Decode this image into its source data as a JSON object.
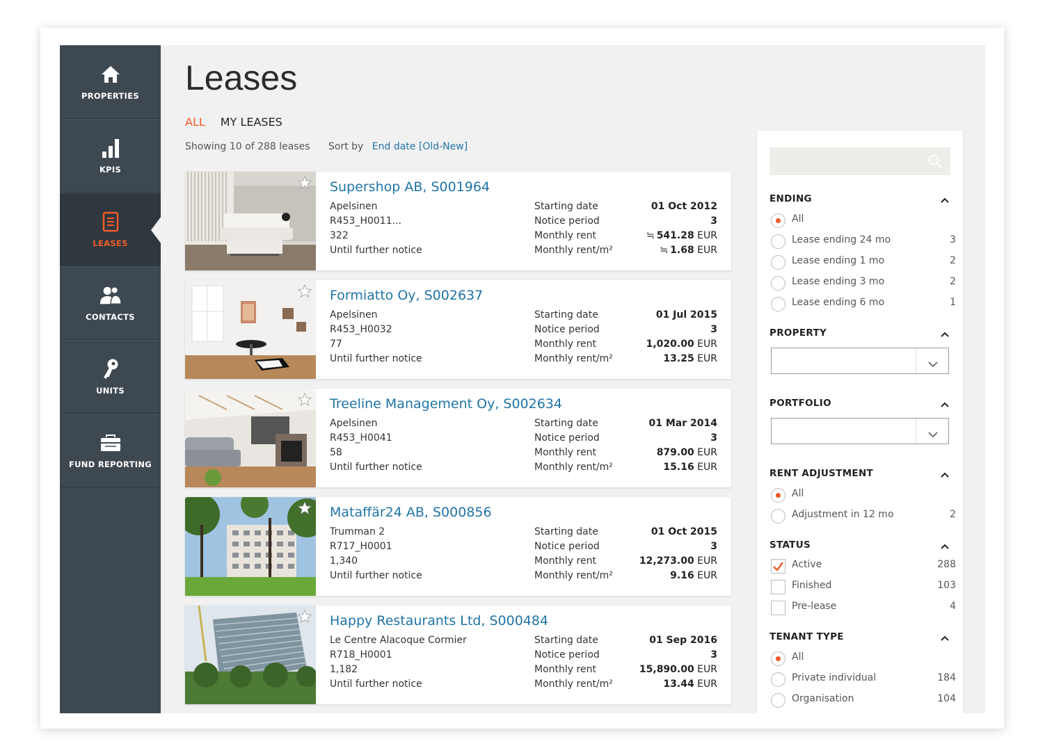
{
  "sidebar": {
    "items": [
      {
        "label": "PROPERTIES",
        "icon": "home-icon",
        "active": false
      },
      {
        "label": "KPIS",
        "icon": "bar-chart-icon",
        "active": false
      },
      {
        "label": "LEASES",
        "icon": "document-icon",
        "active": true
      },
      {
        "label": "CONTACTS",
        "icon": "people-icon",
        "active": false
      },
      {
        "label": "UNITS",
        "icon": "key-icon",
        "active": false
      },
      {
        "label": "FUND REPORTING",
        "icon": "briefcase-icon",
        "active": false
      }
    ]
  },
  "page": {
    "title": "Leases",
    "tabs": [
      "ALL",
      "MY LEASES"
    ],
    "showing": "Showing 10 of 288 leases",
    "sort_label": "Sort by",
    "sort_value": "End date [Old-New]"
  },
  "labels": {
    "starting_date": "Starting date",
    "notice_period": "Notice period",
    "monthly_rent": "Monthly rent",
    "monthly_rent_m2": "Monthly rent/m²",
    "currency": "EUR",
    "approx": "≒"
  },
  "leases": [
    {
      "title": "Supershop AB, S001964",
      "property": "Apelsinen",
      "unit": "R453_H0011...",
      "area": "322",
      "term": "Until further notice",
      "start": "01 Oct 2012",
      "notice": "3",
      "rent": "541.28",
      "rent_m2": "1.68",
      "approx": true
    },
    {
      "title": "Formiatto Oy, S002637",
      "property": "Apelsinen",
      "unit": "R453_H0032",
      "area": "77",
      "term": "Until further notice",
      "start": "01 Jul 2015",
      "notice": "3",
      "rent": "1,020.00",
      "rent_m2": "13.25",
      "approx": false
    },
    {
      "title": "Treeline Management Oy, S002634",
      "property": "Apelsinen",
      "unit": "R453_H0041",
      "area": "58",
      "term": "Until further notice",
      "start": "01 Mar 2014",
      "notice": "3",
      "rent": "879.00",
      "rent_m2": "15.16",
      "approx": false
    },
    {
      "title": "Mataffär24 AB, S000856",
      "property": "Trumman 2",
      "unit": "R717_H0001",
      "area": "1,340",
      "term": "Until further notice",
      "start": "01 Oct 2015",
      "notice": "3",
      "rent": "12,273.00",
      "rent_m2": "9.16",
      "approx": false
    },
    {
      "title": "Happy Restaurants Ltd, S000484",
      "property": "Le Centre Alacoque Cormier",
      "unit": "R718_H0001",
      "area": "1,182",
      "term": "Until further notice",
      "start": "01 Sep 2016",
      "notice": "3",
      "rent": "15,890.00",
      "rent_m2": "13.44",
      "approx": false
    }
  ],
  "filters": {
    "ending": {
      "title": "ENDING",
      "options": [
        {
          "label": "All",
          "count": "",
          "selected": true
        },
        {
          "label": "Lease ending 24 mo",
          "count": "3",
          "selected": false
        },
        {
          "label": "Lease ending 1 mo",
          "count": "2",
          "selected": false
        },
        {
          "label": "Lease ending 3 mo",
          "count": "2",
          "selected": false
        },
        {
          "label": "Lease ending 6 mo",
          "count": "1",
          "selected": false
        }
      ]
    },
    "property": {
      "title": "PROPERTY"
    },
    "portfolio": {
      "title": "PORTFOLIO"
    },
    "rent_adjustment": {
      "title": "RENT ADJUSTMENT",
      "options": [
        {
          "label": "All",
          "count": "",
          "selected": true
        },
        {
          "label": "Adjustment in 12 mo",
          "count": "2",
          "selected": false
        }
      ]
    },
    "status": {
      "title": "STATUS",
      "options": [
        {
          "label": "Active",
          "count": "288",
          "checked": true
        },
        {
          "label": "Finished",
          "count": "103",
          "checked": false
        },
        {
          "label": "Pre-lease",
          "count": "4",
          "checked": false
        }
      ]
    },
    "tenant_type": {
      "title": "TENANT TYPE",
      "options": [
        {
          "label": "All",
          "count": "",
          "selected": true
        },
        {
          "label": "Private individual",
          "count": "184",
          "selected": false
        },
        {
          "label": "Organisation",
          "count": "104",
          "selected": false
        }
      ]
    }
  },
  "colors": {
    "accent": "#f05a28",
    "link": "#1f74a6",
    "sidebar": "#3e4851"
  }
}
